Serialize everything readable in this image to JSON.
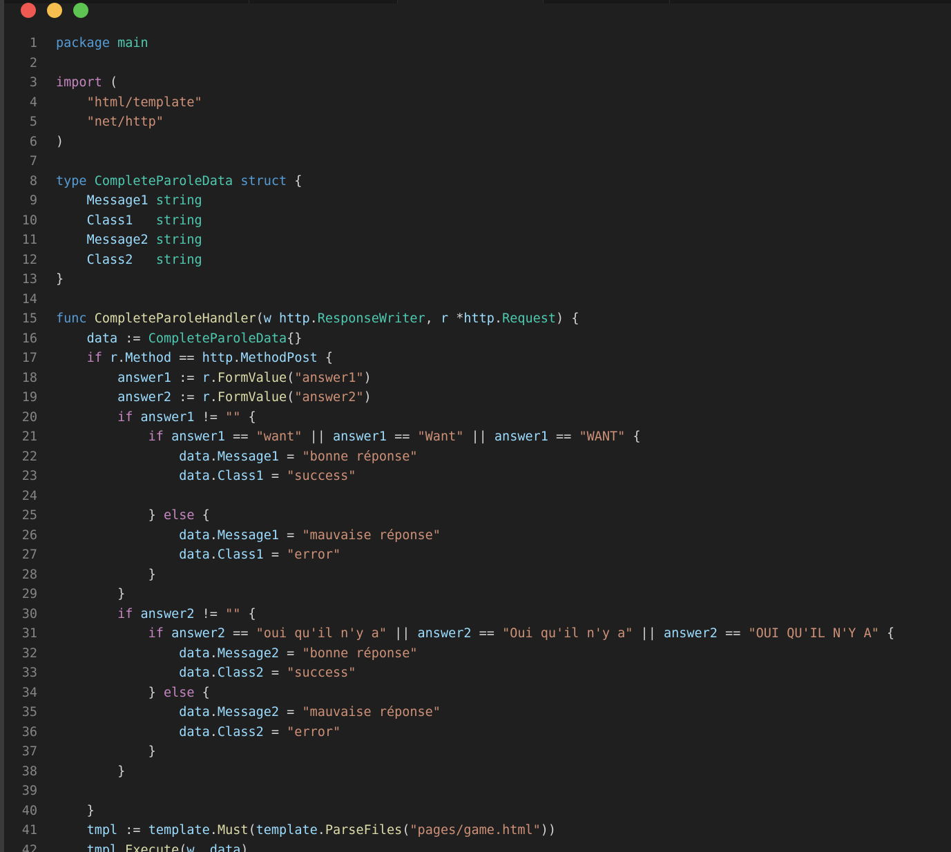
{
  "window_controls": {
    "close": "close",
    "minimize": "minimize",
    "zoom": "zoom"
  },
  "editor": {
    "lines": [
      {
        "n": "1",
        "tokens": [
          {
            "t": "package",
            "c": "kw"
          },
          {
            "t": " ",
            "c": "pl"
          },
          {
            "t": "main",
            "c": "ty"
          }
        ]
      },
      {
        "n": "2",
        "tokens": []
      },
      {
        "n": "3",
        "tokens": [
          {
            "t": "import",
            "c": "ctl"
          },
          {
            "t": " (",
            "c": "pl"
          }
        ]
      },
      {
        "n": "4",
        "tokens": [
          {
            "t": "    ",
            "c": "pl"
          },
          {
            "t": "\"html/template\"",
            "c": "str"
          }
        ]
      },
      {
        "n": "5",
        "tokens": [
          {
            "t": "    ",
            "c": "pl"
          },
          {
            "t": "\"net/http\"",
            "c": "str"
          }
        ]
      },
      {
        "n": "6",
        "tokens": [
          {
            "t": ")",
            "c": "pl"
          }
        ]
      },
      {
        "n": "7",
        "tokens": []
      },
      {
        "n": "8",
        "tokens": [
          {
            "t": "type",
            "c": "kw"
          },
          {
            "t": " ",
            "c": "pl"
          },
          {
            "t": "CompleteParoleData",
            "c": "ty"
          },
          {
            "t": " ",
            "c": "pl"
          },
          {
            "t": "struct",
            "c": "kw"
          },
          {
            "t": " {",
            "c": "pl"
          }
        ]
      },
      {
        "n": "9",
        "tokens": [
          {
            "t": "    ",
            "c": "pl"
          },
          {
            "t": "Message1",
            "c": "vr"
          },
          {
            "t": " ",
            "c": "pl"
          },
          {
            "t": "string",
            "c": "ty"
          }
        ]
      },
      {
        "n": "10",
        "tokens": [
          {
            "t": "    ",
            "c": "pl"
          },
          {
            "t": "Class1",
            "c": "vr"
          },
          {
            "t": "   ",
            "c": "pl"
          },
          {
            "t": "string",
            "c": "ty"
          }
        ]
      },
      {
        "n": "11",
        "tokens": [
          {
            "t": "    ",
            "c": "pl"
          },
          {
            "t": "Message2",
            "c": "vr"
          },
          {
            "t": " ",
            "c": "pl"
          },
          {
            "t": "string",
            "c": "ty"
          }
        ]
      },
      {
        "n": "12",
        "tokens": [
          {
            "t": "    ",
            "c": "pl"
          },
          {
            "t": "Class2",
            "c": "vr"
          },
          {
            "t": "   ",
            "c": "pl"
          },
          {
            "t": "string",
            "c": "ty"
          }
        ]
      },
      {
        "n": "13",
        "tokens": [
          {
            "t": "}",
            "c": "pl"
          }
        ]
      },
      {
        "n": "14",
        "tokens": []
      },
      {
        "n": "15",
        "tokens": [
          {
            "t": "func",
            "c": "kw"
          },
          {
            "t": " ",
            "c": "pl"
          },
          {
            "t": "CompleteParoleHandler",
            "c": "fn"
          },
          {
            "t": "(",
            "c": "pl"
          },
          {
            "t": "w",
            "c": "vr"
          },
          {
            "t": " ",
            "c": "pl"
          },
          {
            "t": "http",
            "c": "vr"
          },
          {
            "t": ".",
            "c": "pl"
          },
          {
            "t": "ResponseWriter",
            "c": "ty"
          },
          {
            "t": ", ",
            "c": "pl"
          },
          {
            "t": "r",
            "c": "vr"
          },
          {
            "t": " *",
            "c": "pl"
          },
          {
            "t": "http",
            "c": "vr"
          },
          {
            "t": ".",
            "c": "pl"
          },
          {
            "t": "Request",
            "c": "ty"
          },
          {
            "t": ") {",
            "c": "pl"
          }
        ]
      },
      {
        "n": "16",
        "tokens": [
          {
            "t": "    ",
            "c": "pl"
          },
          {
            "t": "data",
            "c": "vr"
          },
          {
            "t": " := ",
            "c": "pl"
          },
          {
            "t": "CompleteParoleData",
            "c": "ty"
          },
          {
            "t": "{}",
            "c": "pl"
          }
        ]
      },
      {
        "n": "17",
        "tokens": [
          {
            "t": "    ",
            "c": "pl"
          },
          {
            "t": "if",
            "c": "ctl"
          },
          {
            "t": " ",
            "c": "pl"
          },
          {
            "t": "r",
            "c": "vr"
          },
          {
            "t": ".",
            "c": "pl"
          },
          {
            "t": "Method",
            "c": "vr"
          },
          {
            "t": " == ",
            "c": "pl"
          },
          {
            "t": "http",
            "c": "vr"
          },
          {
            "t": ".",
            "c": "pl"
          },
          {
            "t": "MethodPost",
            "c": "vr"
          },
          {
            "t": " {",
            "c": "pl"
          }
        ]
      },
      {
        "n": "18",
        "tokens": [
          {
            "t": "        ",
            "c": "pl"
          },
          {
            "t": "answer1",
            "c": "vr"
          },
          {
            "t": " := ",
            "c": "pl"
          },
          {
            "t": "r",
            "c": "vr"
          },
          {
            "t": ".",
            "c": "pl"
          },
          {
            "t": "FormValue",
            "c": "fn"
          },
          {
            "t": "(",
            "c": "pl"
          },
          {
            "t": "\"answer1\"",
            "c": "str"
          },
          {
            "t": ")",
            "c": "pl"
          }
        ]
      },
      {
        "n": "19",
        "tokens": [
          {
            "t": "        ",
            "c": "pl"
          },
          {
            "t": "answer2",
            "c": "vr"
          },
          {
            "t": " := ",
            "c": "pl"
          },
          {
            "t": "r",
            "c": "vr"
          },
          {
            "t": ".",
            "c": "pl"
          },
          {
            "t": "FormValue",
            "c": "fn"
          },
          {
            "t": "(",
            "c": "pl"
          },
          {
            "t": "\"answer2\"",
            "c": "str"
          },
          {
            "t": ")",
            "c": "pl"
          }
        ]
      },
      {
        "n": "20",
        "tokens": [
          {
            "t": "        ",
            "c": "pl"
          },
          {
            "t": "if",
            "c": "ctl"
          },
          {
            "t": " ",
            "c": "pl"
          },
          {
            "t": "answer1",
            "c": "vr"
          },
          {
            "t": " != ",
            "c": "pl"
          },
          {
            "t": "\"\"",
            "c": "str"
          },
          {
            "t": " {",
            "c": "pl"
          }
        ]
      },
      {
        "n": "21",
        "tokens": [
          {
            "t": "            ",
            "c": "pl"
          },
          {
            "t": "if",
            "c": "ctl"
          },
          {
            "t": " ",
            "c": "pl"
          },
          {
            "t": "answer1",
            "c": "vr"
          },
          {
            "t": " == ",
            "c": "pl"
          },
          {
            "t": "\"want\"",
            "c": "str"
          },
          {
            "t": " || ",
            "c": "pl"
          },
          {
            "t": "answer1",
            "c": "vr"
          },
          {
            "t": " == ",
            "c": "pl"
          },
          {
            "t": "\"Want\"",
            "c": "str"
          },
          {
            "t": " || ",
            "c": "pl"
          },
          {
            "t": "answer1",
            "c": "vr"
          },
          {
            "t": " == ",
            "c": "pl"
          },
          {
            "t": "\"WANT\"",
            "c": "str"
          },
          {
            "t": " {",
            "c": "pl"
          }
        ]
      },
      {
        "n": "22",
        "tokens": [
          {
            "t": "                ",
            "c": "pl"
          },
          {
            "t": "data",
            "c": "vr"
          },
          {
            "t": ".",
            "c": "pl"
          },
          {
            "t": "Message1",
            "c": "vr"
          },
          {
            "t": " = ",
            "c": "pl"
          },
          {
            "t": "\"bonne réponse\"",
            "c": "str"
          }
        ]
      },
      {
        "n": "23",
        "tokens": [
          {
            "t": "                ",
            "c": "pl"
          },
          {
            "t": "data",
            "c": "vr"
          },
          {
            "t": ".",
            "c": "pl"
          },
          {
            "t": "Class1",
            "c": "vr"
          },
          {
            "t": " = ",
            "c": "pl"
          },
          {
            "t": "\"success\"",
            "c": "str"
          }
        ]
      },
      {
        "n": "24",
        "tokens": []
      },
      {
        "n": "25",
        "tokens": [
          {
            "t": "            ",
            "c": "pl"
          },
          {
            "t": "} ",
            "c": "pl"
          },
          {
            "t": "else",
            "c": "ctl"
          },
          {
            "t": " {",
            "c": "pl"
          }
        ]
      },
      {
        "n": "26",
        "tokens": [
          {
            "t": "                ",
            "c": "pl"
          },
          {
            "t": "data",
            "c": "vr"
          },
          {
            "t": ".",
            "c": "pl"
          },
          {
            "t": "Message1",
            "c": "vr"
          },
          {
            "t": " = ",
            "c": "pl"
          },
          {
            "t": "\"mauvaise réponse\"",
            "c": "str"
          }
        ]
      },
      {
        "n": "27",
        "tokens": [
          {
            "t": "                ",
            "c": "pl"
          },
          {
            "t": "data",
            "c": "vr"
          },
          {
            "t": ".",
            "c": "pl"
          },
          {
            "t": "Class1",
            "c": "vr"
          },
          {
            "t": " = ",
            "c": "pl"
          },
          {
            "t": "\"error\"",
            "c": "str"
          }
        ]
      },
      {
        "n": "28",
        "tokens": [
          {
            "t": "            ",
            "c": "pl"
          },
          {
            "t": "}",
            "c": "pl"
          }
        ]
      },
      {
        "n": "29",
        "tokens": [
          {
            "t": "        ",
            "c": "pl"
          },
          {
            "t": "}",
            "c": "pl"
          }
        ]
      },
      {
        "n": "30",
        "tokens": [
          {
            "t": "        ",
            "c": "pl"
          },
          {
            "t": "if",
            "c": "ctl"
          },
          {
            "t": " ",
            "c": "pl"
          },
          {
            "t": "answer2",
            "c": "vr"
          },
          {
            "t": " != ",
            "c": "pl"
          },
          {
            "t": "\"\"",
            "c": "str"
          },
          {
            "t": " {",
            "c": "pl"
          }
        ]
      },
      {
        "n": "31",
        "tokens": [
          {
            "t": "            ",
            "c": "pl"
          },
          {
            "t": "if",
            "c": "ctl"
          },
          {
            "t": " ",
            "c": "pl"
          },
          {
            "t": "answer2",
            "c": "vr"
          },
          {
            "t": " == ",
            "c": "pl"
          },
          {
            "t": "\"oui qu'il n'y a\"",
            "c": "str"
          },
          {
            "t": " || ",
            "c": "pl"
          },
          {
            "t": "answer2",
            "c": "vr"
          },
          {
            "t": " == ",
            "c": "pl"
          },
          {
            "t": "\"Oui qu'il n'y a\"",
            "c": "str"
          },
          {
            "t": " || ",
            "c": "pl"
          },
          {
            "t": "answer2",
            "c": "vr"
          },
          {
            "t": " == ",
            "c": "pl"
          },
          {
            "t": "\"OUI QU'IL N'Y A\"",
            "c": "str"
          },
          {
            "t": " {",
            "c": "pl"
          }
        ]
      },
      {
        "n": "32",
        "tokens": [
          {
            "t": "                ",
            "c": "pl"
          },
          {
            "t": "data",
            "c": "vr"
          },
          {
            "t": ".",
            "c": "pl"
          },
          {
            "t": "Message2",
            "c": "vr"
          },
          {
            "t": " = ",
            "c": "pl"
          },
          {
            "t": "\"bonne réponse\"",
            "c": "str"
          }
        ]
      },
      {
        "n": "33",
        "tokens": [
          {
            "t": "                ",
            "c": "pl"
          },
          {
            "t": "data",
            "c": "vr"
          },
          {
            "t": ".",
            "c": "pl"
          },
          {
            "t": "Class2",
            "c": "vr"
          },
          {
            "t": " = ",
            "c": "pl"
          },
          {
            "t": "\"success\"",
            "c": "str"
          }
        ]
      },
      {
        "n": "34",
        "tokens": [
          {
            "t": "            ",
            "c": "pl"
          },
          {
            "t": "} ",
            "c": "pl"
          },
          {
            "t": "else",
            "c": "ctl"
          },
          {
            "t": " {",
            "c": "pl"
          }
        ]
      },
      {
        "n": "35",
        "tokens": [
          {
            "t": "                ",
            "c": "pl"
          },
          {
            "t": "data",
            "c": "vr"
          },
          {
            "t": ".",
            "c": "pl"
          },
          {
            "t": "Message2",
            "c": "vr"
          },
          {
            "t": " = ",
            "c": "pl"
          },
          {
            "t": "\"mauvaise réponse\"",
            "c": "str"
          }
        ]
      },
      {
        "n": "36",
        "tokens": [
          {
            "t": "                ",
            "c": "pl"
          },
          {
            "t": "data",
            "c": "vr"
          },
          {
            "t": ".",
            "c": "pl"
          },
          {
            "t": "Class2",
            "c": "vr"
          },
          {
            "t": " = ",
            "c": "pl"
          },
          {
            "t": "\"error\"",
            "c": "str"
          }
        ]
      },
      {
        "n": "37",
        "tokens": [
          {
            "t": "            ",
            "c": "pl"
          },
          {
            "t": "}",
            "c": "pl"
          }
        ]
      },
      {
        "n": "38",
        "tokens": [
          {
            "t": "        ",
            "c": "pl"
          },
          {
            "t": "}",
            "c": "pl"
          }
        ]
      },
      {
        "n": "39",
        "tokens": []
      },
      {
        "n": "40",
        "tokens": [
          {
            "t": "    ",
            "c": "pl"
          },
          {
            "t": "}",
            "c": "pl"
          }
        ]
      },
      {
        "n": "41",
        "tokens": [
          {
            "t": "    ",
            "c": "pl"
          },
          {
            "t": "tmpl",
            "c": "vr"
          },
          {
            "t": " := ",
            "c": "pl"
          },
          {
            "t": "template",
            "c": "vr"
          },
          {
            "t": ".",
            "c": "pl"
          },
          {
            "t": "Must",
            "c": "fn"
          },
          {
            "t": "(",
            "c": "pl"
          },
          {
            "t": "template",
            "c": "vr"
          },
          {
            "t": ".",
            "c": "pl"
          },
          {
            "t": "ParseFiles",
            "c": "fn"
          },
          {
            "t": "(",
            "c": "pl"
          },
          {
            "t": "\"pages/game.html\"",
            "c": "str"
          },
          {
            "t": "))",
            "c": "pl"
          }
        ]
      },
      {
        "n": "42",
        "tokens": [
          {
            "t": "    ",
            "c": "pl"
          },
          {
            "t": "tmpl",
            "c": "vr"
          },
          {
            "t": ".",
            "c": "pl"
          },
          {
            "t": "Execute",
            "c": "fn"
          },
          {
            "t": "(",
            "c": "pl"
          },
          {
            "t": "w",
            "c": "vr"
          },
          {
            "t": ", ",
            "c": "pl"
          },
          {
            "t": "data",
            "c": "vr"
          },
          {
            "t": ")",
            "c": "pl"
          }
        ]
      }
    ]
  }
}
